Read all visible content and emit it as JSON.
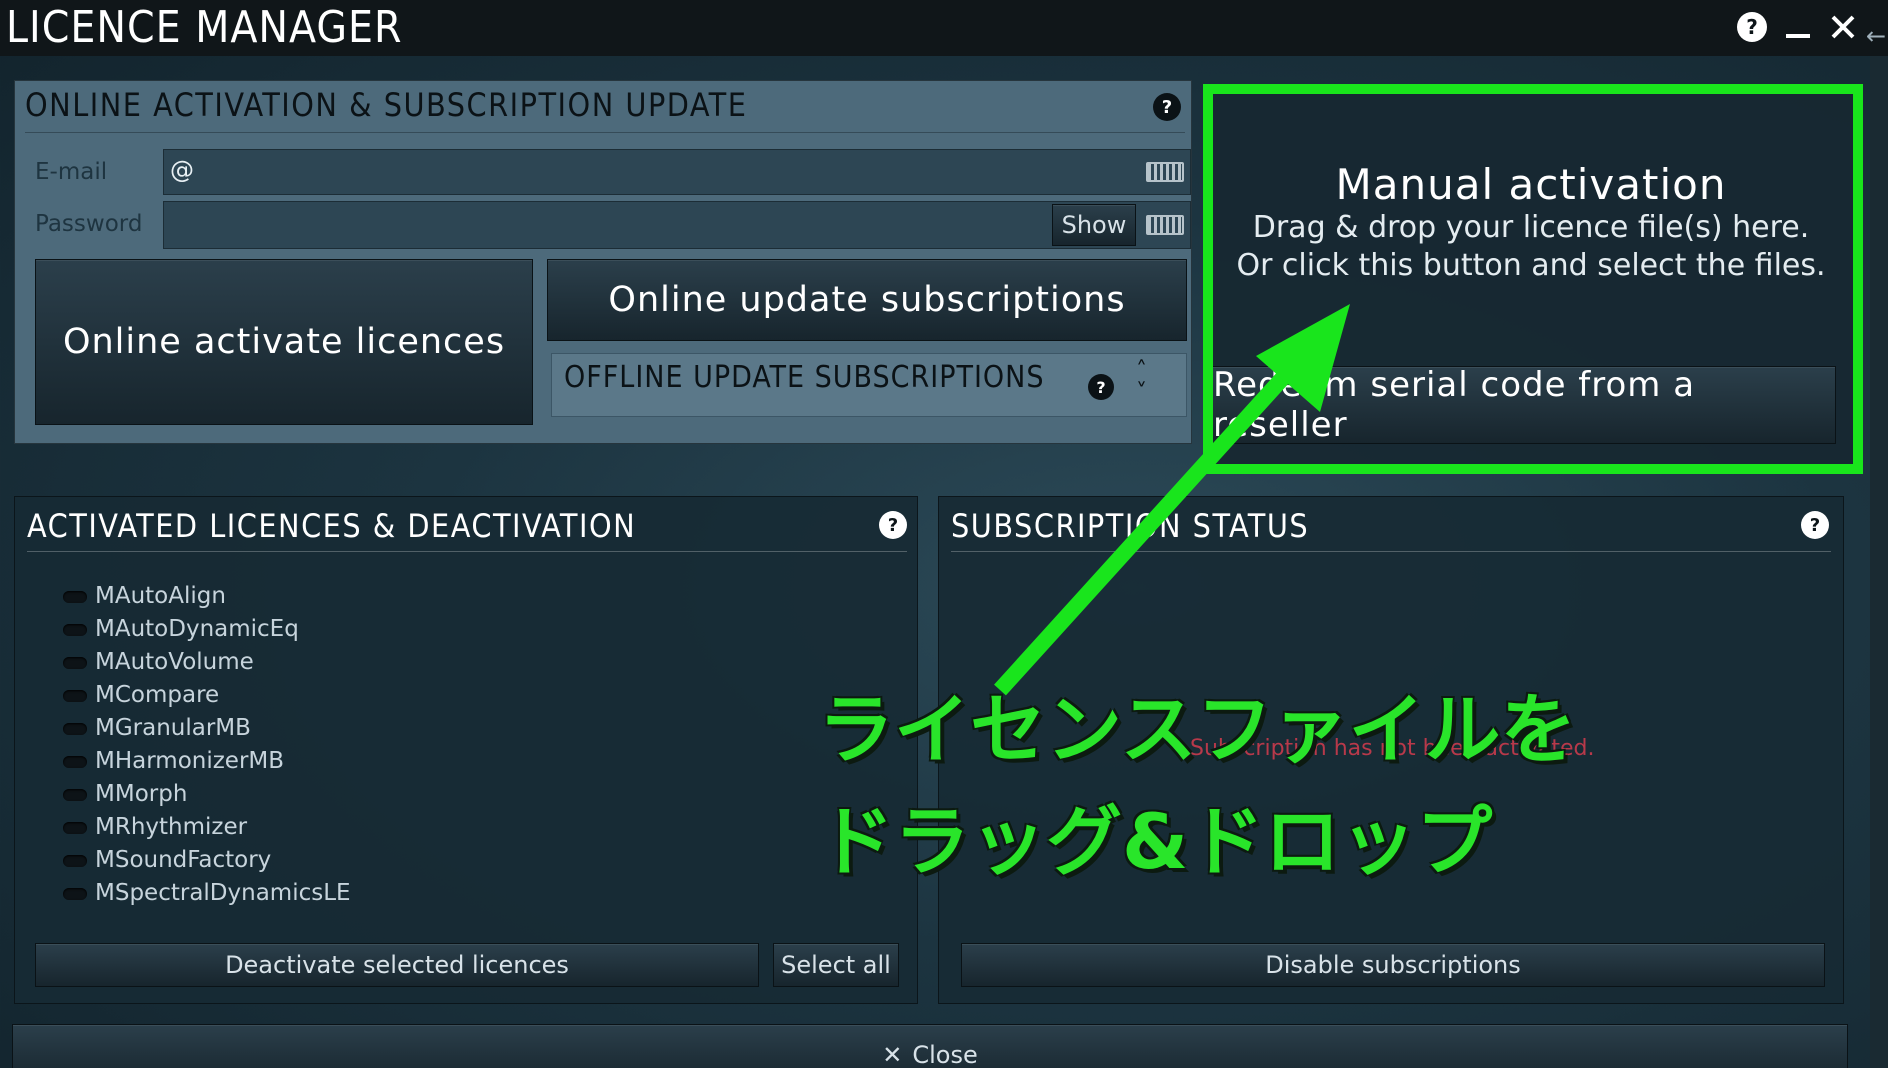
{
  "window": {
    "title": "LICENCE MANAGER"
  },
  "online_activation": {
    "title": "ONLINE ACTIVATION & SUBSCRIPTION UPDATE",
    "email_label": "E-mail",
    "email_value": "@",
    "password_label": "Password",
    "password_value": "",
    "show_label": "Show",
    "activate_label": "Online activate licences",
    "update_label": "Online update subscriptions",
    "offline_label": "OFFLINE UPDATE SUBSCRIPTIONS"
  },
  "manual": {
    "title": "Manual activation",
    "line1": "Drag & drop your licence file(s) here.",
    "line2": "Or click this button and select the files.",
    "redeem_label": "Redeem serial code from a reseller"
  },
  "activated": {
    "title": "ACTIVATED LICENCES & DEACTIVATION",
    "items": [
      "MAutoAlign",
      "MAutoDynamicEq",
      "MAutoVolume",
      "MCompare",
      "MGranularMB",
      "MHarmonizerMB",
      "MMorph",
      "MRhythmizer",
      "MSoundFactory",
      "MSpectralDynamicsLE"
    ],
    "deactivate_label": "Deactivate selected licences",
    "select_all_label": "Select all"
  },
  "subscription": {
    "title": "SUBSCRIPTION STATUS",
    "status_text": "Subscription has not been activated.",
    "disable_label": "Disable subscriptions"
  },
  "footer": {
    "close_label": "Close"
  },
  "annotation": {
    "line1": "ライセンスファイルを",
    "line2": "ドラッグ&ドロップ",
    "color": "#19e51c"
  }
}
